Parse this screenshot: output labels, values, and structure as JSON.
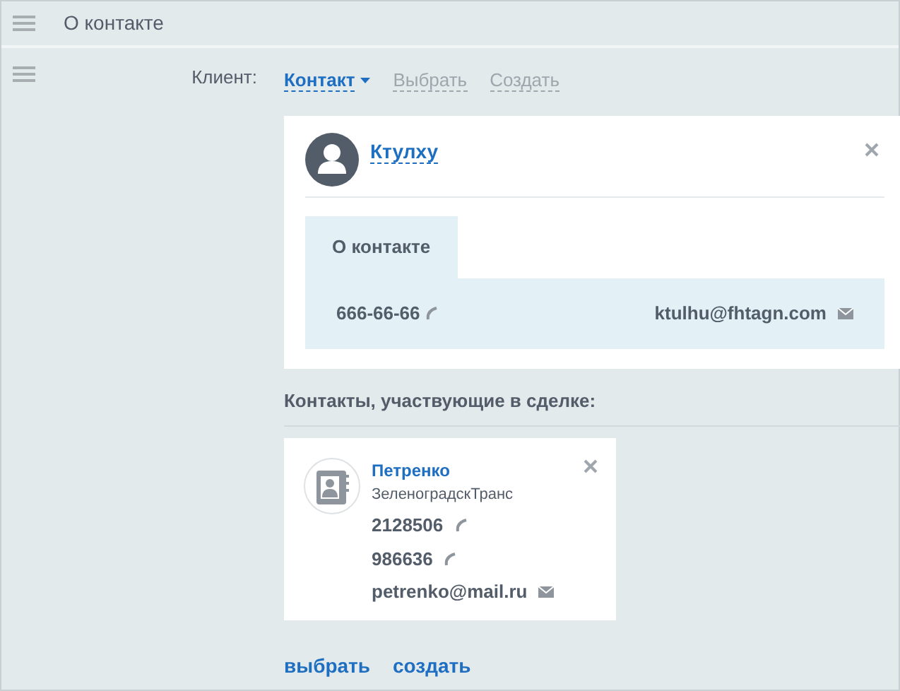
{
  "header": {
    "title": "О контакте"
  },
  "client": {
    "label": "Клиент:",
    "options": [
      {
        "label": "Контакт",
        "selected": true
      },
      {
        "label": "Выбрать",
        "selected": false
      },
      {
        "label": "Создать",
        "selected": false
      }
    ]
  },
  "contact_card": {
    "name": "Ктулху",
    "tabs": [
      {
        "label": "О контакте",
        "selected": true
      }
    ],
    "phone": "666-66-66",
    "email": "ktulhu@fhtagn.com"
  },
  "deal_contacts": {
    "heading": "Контакты, участвующие в сделке:",
    "items": [
      {
        "name": "Петренко",
        "company": "ЗеленоградскТранс",
        "details": [
          {
            "kind": "phone",
            "value": "2128506"
          },
          {
            "kind": "phone",
            "value": "986636"
          },
          {
            "kind": "email",
            "value": "petrenko@mail.ru"
          }
        ]
      }
    ],
    "actions": [
      "выбрать",
      "создать"
    ]
  }
}
